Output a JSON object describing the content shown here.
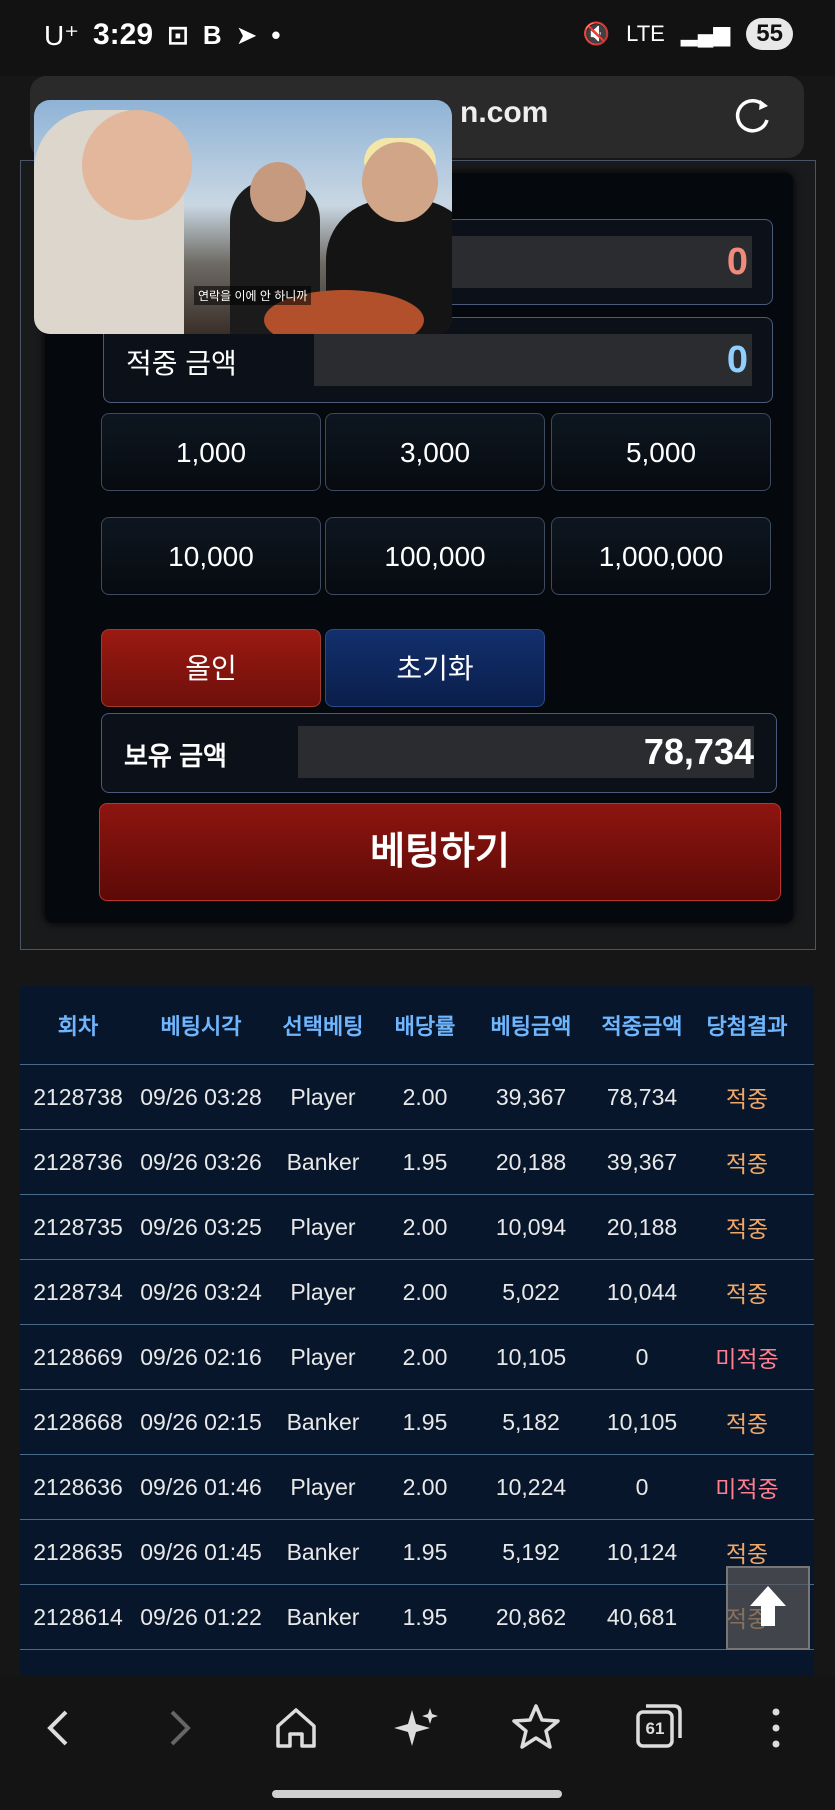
{
  "status_bar": {
    "carrier": "U⁺",
    "time": "3:29",
    "battery": "55",
    "network": "LTE"
  },
  "browser": {
    "url_visible": "n.com"
  },
  "video": {
    "subtitle": "연락을 이에 안 하니까"
  },
  "bet_panel": {
    "bet_amount_value": "0",
    "win_amount_label": "적중 금액",
    "win_amount_value": "0",
    "chips": [
      "1,000",
      "3,000",
      "5,000",
      "10,000",
      "100,000",
      "1,000,000"
    ],
    "allin_label": "올인",
    "reset_label": "초기화",
    "balance_label": "보유 금액",
    "balance_value": "78,734",
    "bet_button_label": "베팅하기"
  },
  "history": {
    "headers": [
      "회차",
      "베팅시각",
      "선택베팅",
      "배당률",
      "베팅금액",
      "적중금액",
      "당첨결과"
    ],
    "rows": [
      [
        "2128738",
        "09/26 03:28",
        "Player",
        "2.00",
        "39,367",
        "78,734",
        "적중"
      ],
      [
        "2128736",
        "09/26 03:26",
        "Banker",
        "1.95",
        "20,188",
        "39,367",
        "적중"
      ],
      [
        "2128735",
        "09/26 03:25",
        "Player",
        "2.00",
        "10,094",
        "20,188",
        "적중"
      ],
      [
        "2128734",
        "09/26 03:24",
        "Player",
        "2.00",
        "5,022",
        "10,044",
        "적중"
      ],
      [
        "2128669",
        "09/26 02:16",
        "Player",
        "2.00",
        "10,105",
        "0",
        "미적중"
      ],
      [
        "2128668",
        "09/26 02:15",
        "Banker",
        "1.95",
        "5,182",
        "10,105",
        "적중"
      ],
      [
        "2128636",
        "09/26 01:46",
        "Player",
        "2.00",
        "10,224",
        "0",
        "미적중"
      ],
      [
        "2128635",
        "09/26 01:45",
        "Banker",
        "1.95",
        "5,192",
        "10,124",
        "적중"
      ],
      [
        "2128614",
        "09/26 01:22",
        "Banker",
        "1.95",
        "20,862",
        "40,681",
        "적중"
      ]
    ]
  },
  "nav": {
    "tabs_count": "61"
  },
  "colors": {
    "win": "#f0a868",
    "lose": "#ff7f8f",
    "header": "#6fb6ff"
  }
}
